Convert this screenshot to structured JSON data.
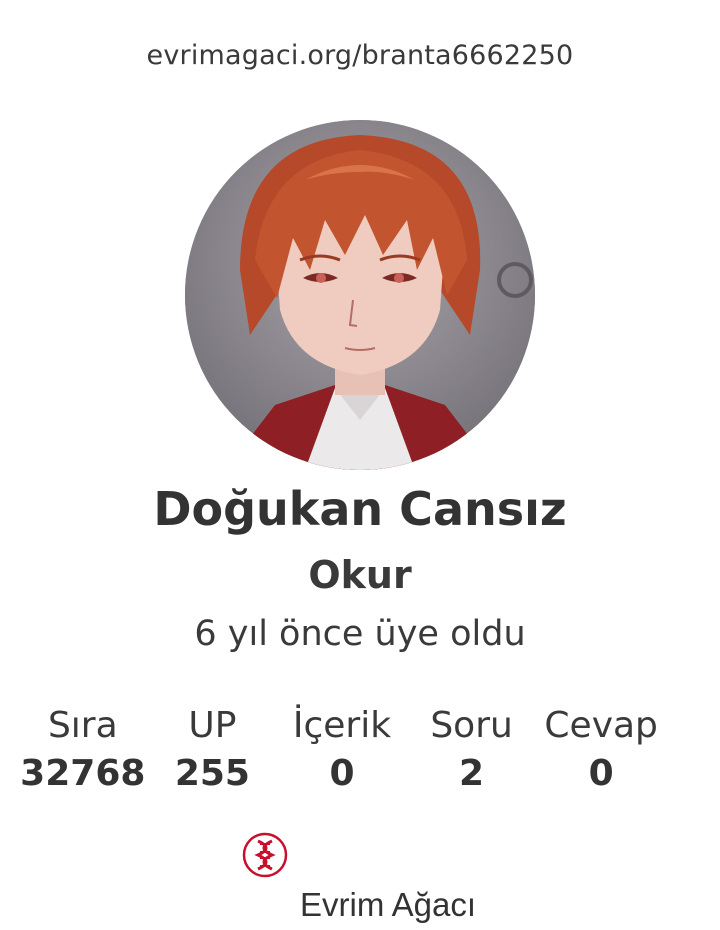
{
  "profile": {
    "url": "evrimagaci.org/branta6662250",
    "name": "Doğukan Cansız",
    "role": "Okur",
    "member_since": "6 yıl önce üye oldu",
    "avatar_icon": "anime-character-avatar"
  },
  "stats": [
    {
      "label": "Sıra",
      "value": "32768"
    },
    {
      "label": "UP",
      "value": "255"
    },
    {
      "label": "İçerik",
      "value": "0"
    },
    {
      "label": "Soru",
      "value": "2"
    },
    {
      "label": "Cevap",
      "value": "0"
    }
  ],
  "brand": {
    "name": "Evrim Ağacı",
    "logo_icon": "dna-icon",
    "accent": "#c8102e"
  }
}
